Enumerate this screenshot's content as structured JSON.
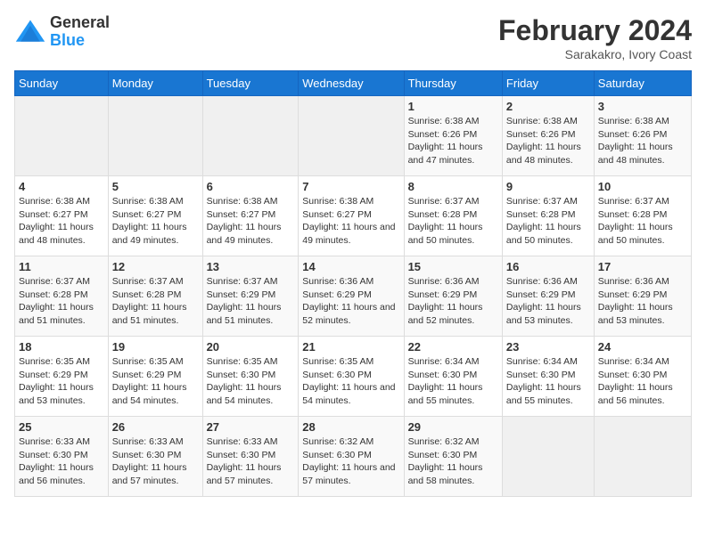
{
  "header": {
    "logo_general": "General",
    "logo_blue": "Blue",
    "main_title": "February 2024",
    "subtitle": "Sarakakro, Ivory Coast"
  },
  "calendar": {
    "days_of_week": [
      "Sunday",
      "Monday",
      "Tuesday",
      "Wednesday",
      "Thursday",
      "Friday",
      "Saturday"
    ],
    "weeks": [
      [
        {
          "day": "",
          "empty": true
        },
        {
          "day": "",
          "empty": true
        },
        {
          "day": "",
          "empty": true
        },
        {
          "day": "",
          "empty": true
        },
        {
          "day": "1",
          "sunrise": "6:38 AM",
          "sunset": "6:26 PM",
          "daylight": "11 hours and 47 minutes."
        },
        {
          "day": "2",
          "sunrise": "6:38 AM",
          "sunset": "6:26 PM",
          "daylight": "11 hours and 48 minutes."
        },
        {
          "day": "3",
          "sunrise": "6:38 AM",
          "sunset": "6:26 PM",
          "daylight": "11 hours and 48 minutes."
        }
      ],
      [
        {
          "day": "4",
          "sunrise": "6:38 AM",
          "sunset": "6:27 PM",
          "daylight": "11 hours and 48 minutes."
        },
        {
          "day": "5",
          "sunrise": "6:38 AM",
          "sunset": "6:27 PM",
          "daylight": "11 hours and 49 minutes."
        },
        {
          "day": "6",
          "sunrise": "6:38 AM",
          "sunset": "6:27 PM",
          "daylight": "11 hours and 49 minutes."
        },
        {
          "day": "7",
          "sunrise": "6:38 AM",
          "sunset": "6:27 PM",
          "daylight": "11 hours and 49 minutes."
        },
        {
          "day": "8",
          "sunrise": "6:37 AM",
          "sunset": "6:28 PM",
          "daylight": "11 hours and 50 minutes."
        },
        {
          "day": "9",
          "sunrise": "6:37 AM",
          "sunset": "6:28 PM",
          "daylight": "11 hours and 50 minutes."
        },
        {
          "day": "10",
          "sunrise": "6:37 AM",
          "sunset": "6:28 PM",
          "daylight": "11 hours and 50 minutes."
        }
      ],
      [
        {
          "day": "11",
          "sunrise": "6:37 AM",
          "sunset": "6:28 PM",
          "daylight": "11 hours and 51 minutes."
        },
        {
          "day": "12",
          "sunrise": "6:37 AM",
          "sunset": "6:28 PM",
          "daylight": "11 hours and 51 minutes."
        },
        {
          "day": "13",
          "sunrise": "6:37 AM",
          "sunset": "6:29 PM",
          "daylight": "11 hours and 51 minutes."
        },
        {
          "day": "14",
          "sunrise": "6:36 AM",
          "sunset": "6:29 PM",
          "daylight": "11 hours and 52 minutes."
        },
        {
          "day": "15",
          "sunrise": "6:36 AM",
          "sunset": "6:29 PM",
          "daylight": "11 hours and 52 minutes."
        },
        {
          "day": "16",
          "sunrise": "6:36 AM",
          "sunset": "6:29 PM",
          "daylight": "11 hours and 53 minutes."
        },
        {
          "day": "17",
          "sunrise": "6:36 AM",
          "sunset": "6:29 PM",
          "daylight": "11 hours and 53 minutes."
        }
      ],
      [
        {
          "day": "18",
          "sunrise": "6:35 AM",
          "sunset": "6:29 PM",
          "daylight": "11 hours and 53 minutes."
        },
        {
          "day": "19",
          "sunrise": "6:35 AM",
          "sunset": "6:29 PM",
          "daylight": "11 hours and 54 minutes."
        },
        {
          "day": "20",
          "sunrise": "6:35 AM",
          "sunset": "6:30 PM",
          "daylight": "11 hours and 54 minutes."
        },
        {
          "day": "21",
          "sunrise": "6:35 AM",
          "sunset": "6:30 PM",
          "daylight": "11 hours and 54 minutes."
        },
        {
          "day": "22",
          "sunrise": "6:34 AM",
          "sunset": "6:30 PM",
          "daylight": "11 hours and 55 minutes."
        },
        {
          "day": "23",
          "sunrise": "6:34 AM",
          "sunset": "6:30 PM",
          "daylight": "11 hours and 55 minutes."
        },
        {
          "day": "24",
          "sunrise": "6:34 AM",
          "sunset": "6:30 PM",
          "daylight": "11 hours and 56 minutes."
        }
      ],
      [
        {
          "day": "25",
          "sunrise": "6:33 AM",
          "sunset": "6:30 PM",
          "daylight": "11 hours and 56 minutes."
        },
        {
          "day": "26",
          "sunrise": "6:33 AM",
          "sunset": "6:30 PM",
          "daylight": "11 hours and 57 minutes."
        },
        {
          "day": "27",
          "sunrise": "6:33 AM",
          "sunset": "6:30 PM",
          "daylight": "11 hours and 57 minutes."
        },
        {
          "day": "28",
          "sunrise": "6:32 AM",
          "sunset": "6:30 PM",
          "daylight": "11 hours and 57 minutes."
        },
        {
          "day": "29",
          "sunrise": "6:32 AM",
          "sunset": "6:30 PM",
          "daylight": "11 hours and 58 minutes."
        },
        {
          "day": "",
          "empty": true
        },
        {
          "day": "",
          "empty": true
        }
      ]
    ]
  },
  "labels": {
    "sunrise_label": "Sunrise:",
    "sunset_label": "Sunset:",
    "daylight_label": "Daylight:"
  }
}
